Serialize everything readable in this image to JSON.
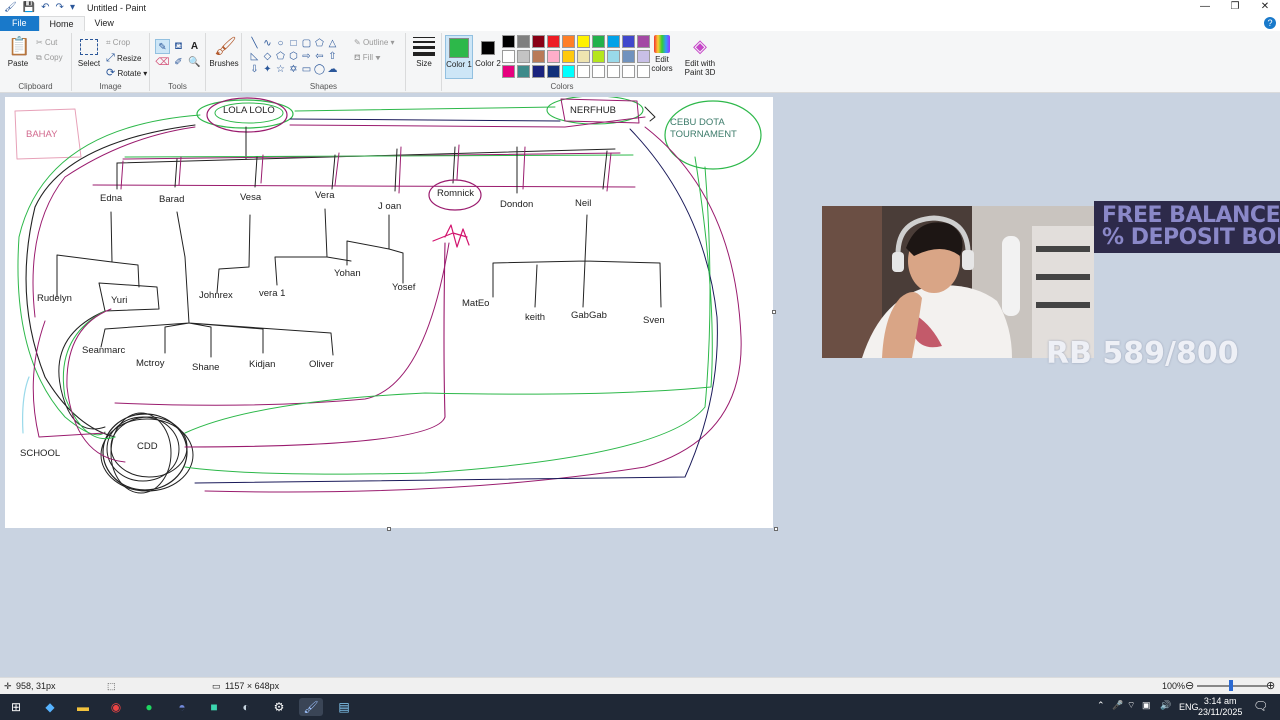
{
  "window": {
    "title": "Untitled - Paint",
    "controls": [
      "—",
      "❐",
      "✕"
    ]
  },
  "tabs": {
    "file": "File",
    "home": "Home",
    "view": "View"
  },
  "ribbon": {
    "clipboard": {
      "paste": "Paste",
      "cut": "Cut",
      "copy": "Copy",
      "label": "Clipboard"
    },
    "image": {
      "select": "Select",
      "crop": "Crop",
      "resize": "Resize",
      "rotate": "Rotate",
      "label": "Image"
    },
    "tools": {
      "label": "Tools"
    },
    "brushes": {
      "label": "Brushes"
    },
    "shapes": {
      "outline": "Outline",
      "fill": "Fill",
      "label": "Shapes"
    },
    "size": {
      "label": "Size"
    },
    "colors": {
      "color1": "Color 1",
      "color2": "Color 2",
      "edit_colors": "Edit colors",
      "edit_paint3d": "Edit with Paint 3D",
      "label": "Colors",
      "color1_value": "#2db84a",
      "color2_value": "#000000",
      "palette": [
        "#000000",
        "#7f7f7f",
        "#880015",
        "#ed1c24",
        "#ff7f27",
        "#fff200",
        "#22b14c",
        "#00a2e8",
        "#3f48cc",
        "#a349a4",
        "#ffffff",
        "#c3c3c3",
        "#b97a57",
        "#ffaec9",
        "#ffc90e",
        "#efe4b0",
        "#b5e61d",
        "#99d9ea",
        "#7092be",
        "#c8bfe7",
        "#e6007e",
        "#3d8a8a",
        "#1a237e",
        "#11307a",
        "#00ffff",
        "#ffffff",
        "#ffffff",
        "#ffffff",
        "#ffffff",
        "#ffffff"
      ]
    }
  },
  "canvas": {
    "labels": {
      "bahay": "BAHAY",
      "lola_lolo": "LOLA LOLO",
      "nerfhub": "NERFHUB",
      "cebu": "CEBU DOTA",
      "tournament": "TOURNAMENT",
      "edna": "Edna",
      "barad": "Barad",
      "vesa": "Vesa",
      "vera": "Vera",
      "joan": "J oan",
      "romnick": "Romnick",
      "dondon": "Dondon",
      "neil": "Neil",
      "rudelyn": "Rudelyn",
      "yuri": "Yuri",
      "johnrex": "Johnrex",
      "vera1": "vera 1",
      "yohan": "Yohan",
      "yosef": "Yosef",
      "mateo": "MatEo",
      "keith": "keith",
      "gabgab": "GabGab",
      "sven": "Sven",
      "seanmarc": "Seanmarc",
      "mctroy": "Mctroy",
      "shane": "Shane",
      "kidjan": "Kidjan",
      "oliver": "Oliver",
      "school": "SCHOOL",
      "cdd": "CDD"
    }
  },
  "overlay": {
    "banner_line1": "FREE BALANCE",
    "banner_line2": "% DEPOSIT BON",
    "rb_counter": "RB 589/800"
  },
  "status": {
    "cursor_pos": "958, 31px",
    "canvas_size": "1157 × 648px",
    "zoom": "100%"
  },
  "taskbar": {
    "lang": "ENG",
    "time": "3:14 am",
    "date": "23/11/2025"
  }
}
